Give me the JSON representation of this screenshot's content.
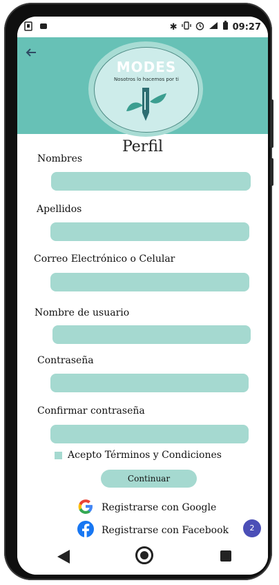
{
  "status_bar": {
    "time": "09:27",
    "left_icons": [
      "usb-icon",
      "notification-icon"
    ],
    "right_icons": [
      "bluetooth-icon",
      "vibrate-icon",
      "alarm-icon",
      "signal-icon",
      "battery-icon"
    ]
  },
  "header": {
    "back_icon": "arrow-left-icon",
    "logo_title": "MODES",
    "logo_subtitle": "Nosotros lo hacemos por ti",
    "color": "#67c1b6"
  },
  "page": {
    "title": "Perfil"
  },
  "form": {
    "nombres_label": "Nombres",
    "nombres_value": "",
    "apellidos_label": "Apellidos",
    "apellidos_value": "",
    "correo_label": "Correo Electrónico o Celular",
    "correo_value": "",
    "usuario_label": "Nombre de usuario",
    "usuario_value": "",
    "password_label": "Contraseña",
    "password_value": "",
    "confirm_label": "Confirmar contraseña",
    "confirm_value": "",
    "field_color": "#a5d9d0"
  },
  "terms": {
    "label": "Acepto Términos y Condiciones",
    "checked": false
  },
  "continue_label": "Continuar",
  "social": {
    "google_label": "Registrarse con Google",
    "facebook_label": "Registrarse con Facebook"
  },
  "badge": {
    "count": "2",
    "color": "#4b4fb7"
  }
}
